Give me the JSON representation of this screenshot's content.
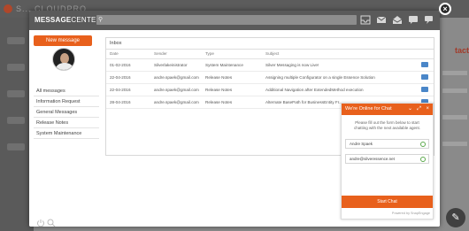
{
  "background": {
    "logo_text": "S... CLOUDPRO",
    "action_label": "tact"
  },
  "modal": {
    "logo_first": "MESSAGE",
    "logo_second": "CENTER",
    "search": {
      "placeholder": "",
      "value": ""
    },
    "toolbar": {
      "icons": [
        "inbox-icon",
        "mail-icon",
        "mail-open-icon",
        "comment-icon",
        "chat-bubble-icon"
      ]
    },
    "close_label": "×"
  },
  "sidebar": {
    "new_message_label": "New message",
    "folders": [
      {
        "label": "All messages"
      },
      {
        "label": "Information Request"
      },
      {
        "label": "General Messages"
      },
      {
        "label": "Release Notes"
      },
      {
        "label": "System Maintenance"
      }
    ]
  },
  "inbox": {
    "title": "Inbox",
    "columns": [
      "Date",
      "Sender",
      "Type",
      "Subject"
    ],
    "rows": [
      {
        "date": "01-02-2016",
        "sender": "Silverlakeinistrator",
        "type": "System Maintenance",
        "subject": "Silver Messaging is now Live!"
      },
      {
        "date": "22-04-2016",
        "sender": "andre.spaek@gmail.com",
        "type": "Release Notes",
        "subject": "Assigning multiple Configurator on a single Essence Solution"
      },
      {
        "date": "22-04-2016",
        "sender": "andre.spaek@gmail.com",
        "type": "Release Notes",
        "subject": "Additional Navigation after ExtendedMethod execution"
      },
      {
        "date": "28-04-2016",
        "sender": "andre.spaek@gmail.com",
        "type": "Release Notes",
        "subject": "Alternate BasePath for BusinessEntity Fr..."
      }
    ]
  },
  "chat": {
    "title": "We're Online for Chat",
    "controls": [
      "⌄",
      "⤢",
      "×"
    ],
    "message": "Please fill out the form below to start chatting with the next available agent.",
    "name_value": "Andre Spaek",
    "email_value": "andre@silveressence.net",
    "start_label": "Start Chat",
    "powered_by": "Powered by SnapEngage"
  },
  "colors": {
    "accent": "#e8601c",
    "header_bg": "#5a5a5a",
    "overlay": "#6e6e6e",
    "row_icon": "#4a86c8"
  },
  "fab_icon": "pencil-icon"
}
